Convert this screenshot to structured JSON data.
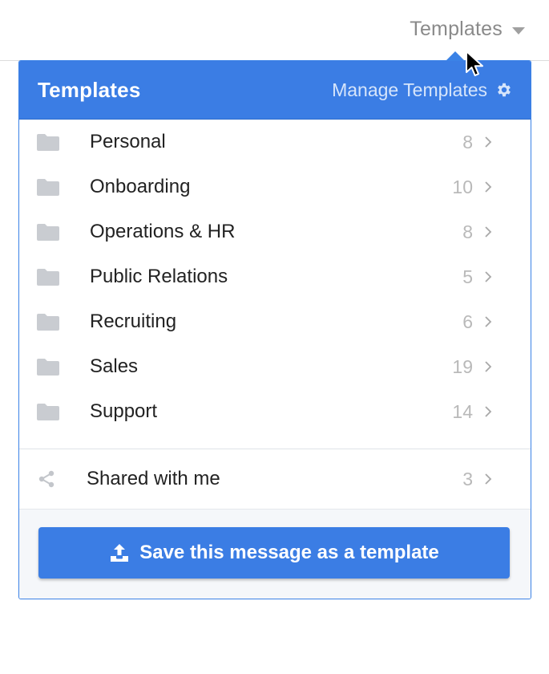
{
  "topbar": {
    "trigger_label": "Templates",
    "caret_icon": "caret-down-icon"
  },
  "panel": {
    "title": "Templates",
    "manage_label": "Manage Templates",
    "manage_icon": "gear-icon",
    "folders": [
      {
        "name": "Personal",
        "count": "8"
      },
      {
        "name": "Onboarding",
        "count": "10"
      },
      {
        "name": "Operations & HR",
        "count": "8"
      },
      {
        "name": "Public Relations",
        "count": "5"
      },
      {
        "name": "Recruiting",
        "count": "6"
      },
      {
        "name": "Sales",
        "count": "19"
      },
      {
        "name": "Support",
        "count": "14"
      }
    ],
    "shared": {
      "name": "Shared with me",
      "count": "3",
      "icon": "share-icon"
    },
    "save_button_label": "Save this message as a template",
    "save_button_icon": "upload-icon"
  },
  "colors": {
    "accent": "#3b7de4",
    "count_gray": "#b9b9b9",
    "text": "#222222"
  }
}
